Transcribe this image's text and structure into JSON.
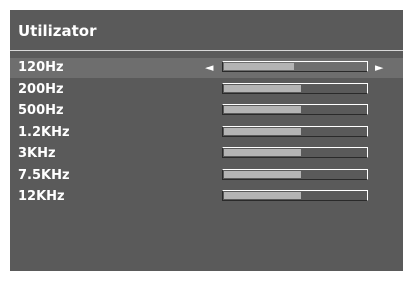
{
  "title": "Utilizator",
  "bands": [
    {
      "label": "120Hz",
      "level": 0.49,
      "selected": true
    },
    {
      "label": "200Hz",
      "level": 0.54,
      "selected": false
    },
    {
      "label": "500Hz",
      "level": 0.54,
      "selected": false
    },
    {
      "label": "1.2KHz",
      "level": 0.54,
      "selected": false
    },
    {
      "label": "3KHz",
      "level": 0.54,
      "selected": false
    },
    {
      "label": "7.5KHz",
      "level": 0.54,
      "selected": false
    },
    {
      "label": "12KHz",
      "level": 0.54,
      "selected": false
    }
  ],
  "arrows": {
    "left": "◄",
    "right": "►"
  },
  "colors": {
    "background": "#5a5a5a",
    "fill": "#b4b4b4",
    "selected_row": "#6e6e6e"
  }
}
